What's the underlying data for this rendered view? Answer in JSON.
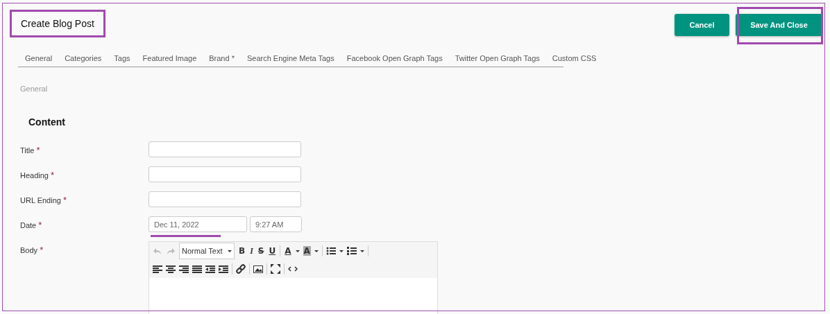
{
  "header": {
    "title": "Create Blog Post",
    "buttons": [
      {
        "label": "Cancel",
        "highlighted": false
      },
      {
        "label": "Save And Close",
        "highlighted": true
      }
    ]
  },
  "tabs": [
    {
      "label": "General"
    },
    {
      "label": "Categories"
    },
    {
      "label": "Tags"
    },
    {
      "label": "Featured Image"
    },
    {
      "label": "Brand *"
    },
    {
      "label": "Search Engine Meta Tags"
    },
    {
      "label": "Facebook Open Graph Tags"
    },
    {
      "label": "Twitter Open Graph Tags"
    },
    {
      "label": "Custom CSS"
    }
  ],
  "section_label": "General",
  "section_title": "Content",
  "fields": [
    {
      "label": "Title",
      "required_mark": "*",
      "kind": "text"
    },
    {
      "label": "Heading",
      "required_mark": "*",
      "kind": "text"
    },
    {
      "label": "URL Ending",
      "required_mark": "*",
      "kind": "text"
    },
    {
      "label": "Date",
      "required_mark": "*",
      "kind": "datetime",
      "date": "Dec 11, 2022",
      "time": "9:27 AM",
      "highlighted": true
    },
    {
      "label": "Body",
      "required_mark": "*",
      "kind": "editor"
    }
  ],
  "editor_toolbar": [
    [
      {
        "kind": "undo",
        "disabled": true
      },
      {
        "kind": "redo",
        "disabled": true
      },
      {
        "kind": "select",
        "label": "Normal Text"
      },
      {
        "kind": "bold",
        "glyph": "B"
      },
      {
        "kind": "italic",
        "glyph": "I"
      },
      {
        "kind": "strike",
        "glyph": "S"
      },
      {
        "kind": "underline",
        "glyph": "U"
      },
      {
        "kind": "sep"
      },
      {
        "kind": "fontcolor",
        "glyph": "A"
      },
      {
        "kind": "highlight",
        "glyph": "A"
      },
      {
        "kind": "sep"
      },
      {
        "kind": "bullets"
      },
      {
        "kind": "numbers"
      },
      {
        "kind": "sep"
      }
    ],
    [
      {
        "kind": "align-left"
      },
      {
        "kind": "align-center"
      },
      {
        "kind": "align-right"
      },
      {
        "kind": "justify"
      },
      {
        "kind": "outdent"
      },
      {
        "kind": "indent"
      },
      {
        "kind": "sep"
      },
      {
        "kind": "link"
      },
      {
        "kind": "sep"
      },
      {
        "kind": "image"
      },
      {
        "kind": "sep"
      },
      {
        "kind": "fullscreen"
      },
      {
        "kind": "sep"
      },
      {
        "kind": "code"
      }
    ]
  ]
}
